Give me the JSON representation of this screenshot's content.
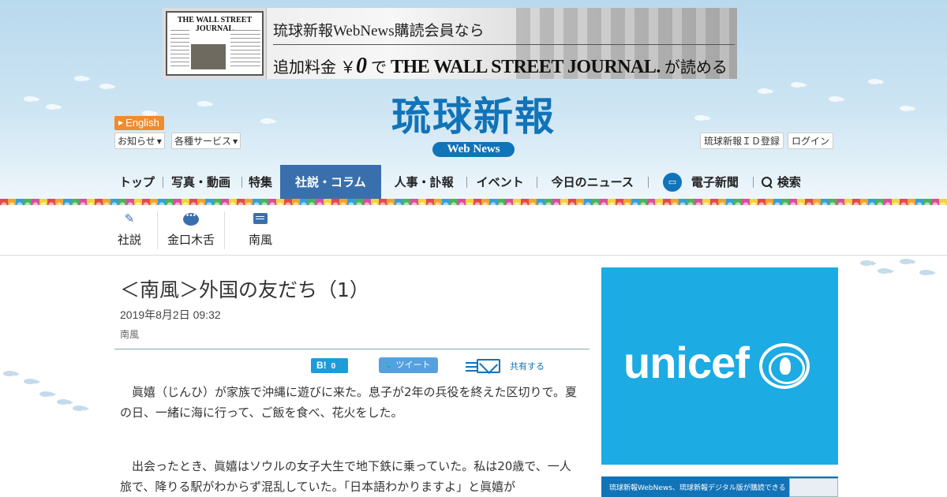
{
  "ad_banner": {
    "laptop_masthead": "THE WALL STREET JOURNAL",
    "line1": "琉球新報WebNews購読会員なら",
    "line2_prefix": "追加料金",
    "line2_yen": "￥",
    "line2_zero": "0",
    "line2_de": "で",
    "line2_brand": "THE WALL STREET JOURNAL.",
    "line2_suffix": "が読める"
  },
  "header": {
    "logo": "琉球新報",
    "logo_sub": "Web News",
    "english_label": "English",
    "notice_label": "お知らせ",
    "services_label": "各種サービス",
    "id_register_label": "琉球新報ＩＤ登録",
    "login_label": "ログイン"
  },
  "nav": {
    "items": [
      {
        "label": "トップ"
      },
      {
        "label": "写真・動画"
      },
      {
        "label": "特集"
      },
      {
        "label": "社説・コラム"
      },
      {
        "label": "人事・訃報"
      },
      {
        "label": "イベント"
      },
      {
        "label": "今日のニュース"
      },
      {
        "label": "電子新聞"
      },
      {
        "label": "検索"
      }
    ],
    "active_index": 3
  },
  "subnav": {
    "items": [
      {
        "label": "社説",
        "icon": "pen-icon"
      },
      {
        "label": "金口木舌",
        "icon": "speech-bubble-icon"
      },
      {
        "label": "南風",
        "icon": "comment-icon"
      }
    ]
  },
  "article": {
    "title": "＜南風＞外国の友だち（1）",
    "date": "2019年8月2日 09:32",
    "category": "南風",
    "share": {
      "hatena_label": "B!",
      "hatena_count": "0",
      "tweet_label": "ツイート",
      "mail_label": "共有する"
    },
    "paragraphs": [
      "　眞嬉（じんひ）が家族で沖縄に遊びに来た。息子が2年の兵役を終えた区切りで。夏の日、一緒に海に行って、ご飯を食べ、花火をした。",
      "　出会ったとき、眞嬉はソウルの女子大生で地下鉄に乗っていた。私は20歳で、一人旅で、降りる駅がわからず混乱していた。「日本語わかりますよ」と眞嬉が"
    ]
  },
  "sidebar": {
    "unicef_text": "unicef",
    "ad2_text": "琉球新報WebNews、琉球新報デジタル版が購読できる"
  },
  "colors": {
    "brand_blue": "#1173b8",
    "nav_active": "#3a6fad",
    "english_orange": "#f08c2e",
    "unicef_blue": "#1cabe2"
  }
}
